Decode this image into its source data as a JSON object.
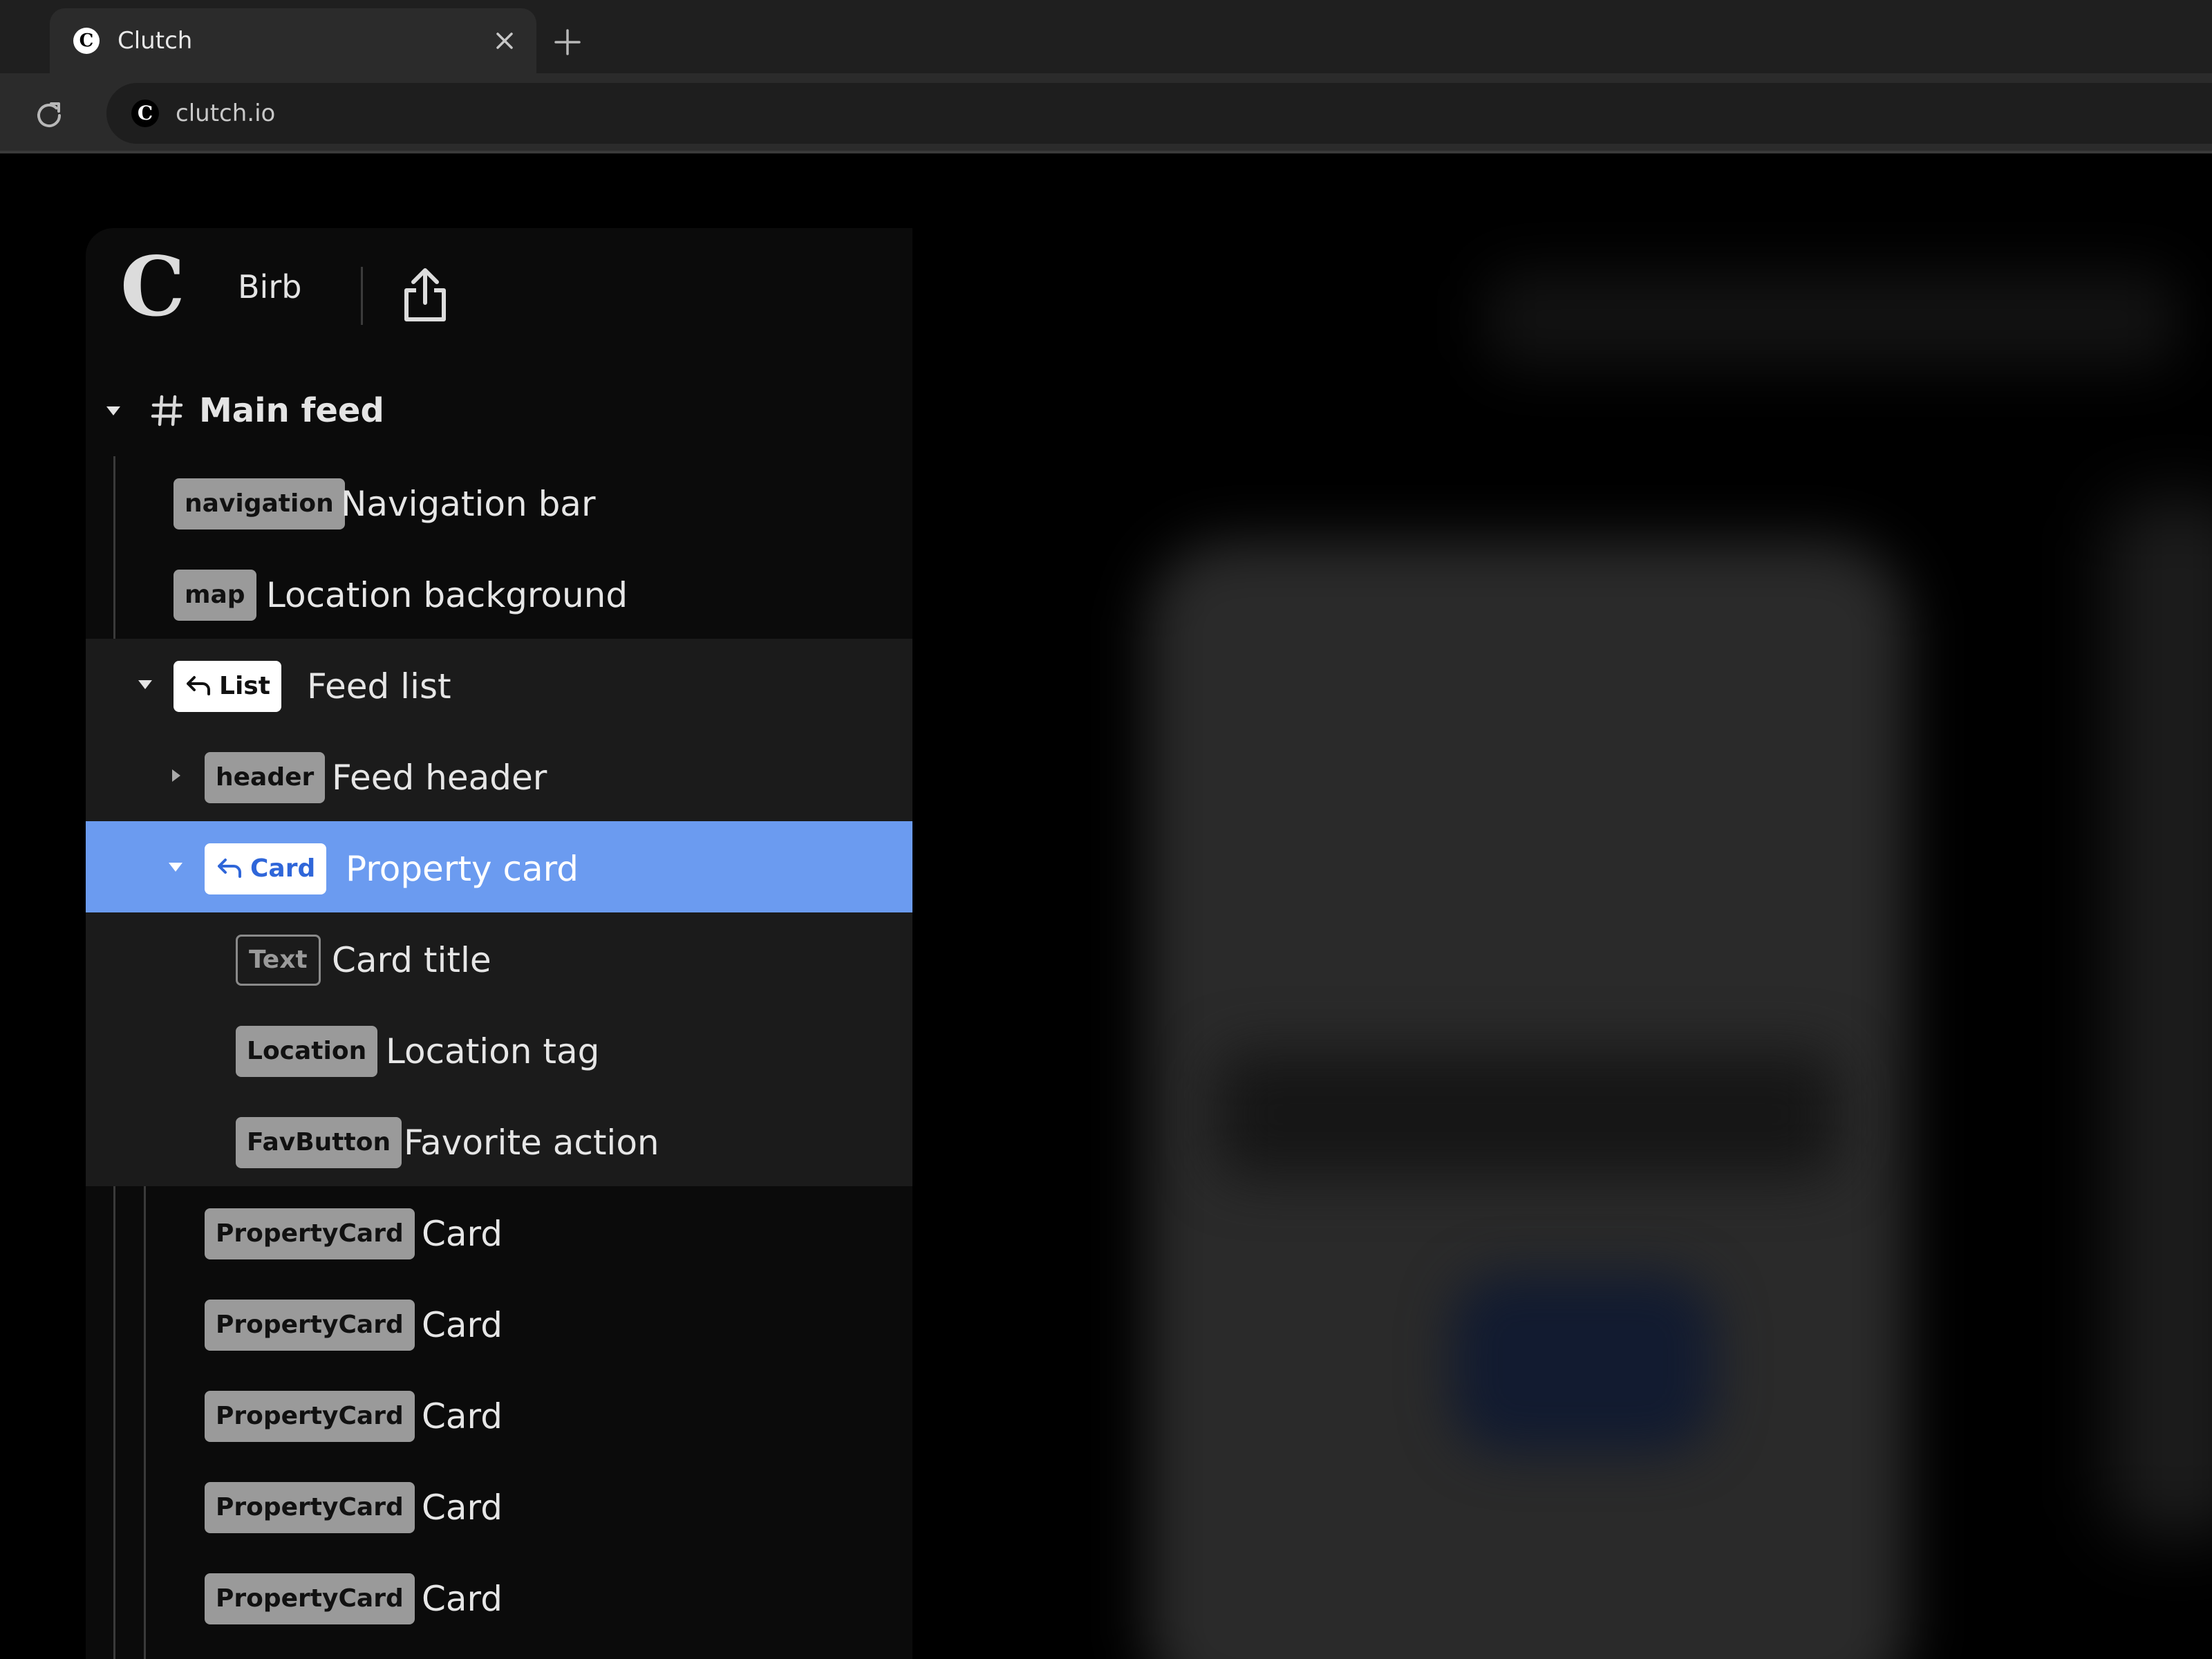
{
  "browser": {
    "tab": {
      "title": "Clutch",
      "favicon": "C",
      "close_icon": "close-icon"
    },
    "new_tab_icon": "plus-icon",
    "reload_icon": "reload-icon",
    "address": {
      "favicon": "C",
      "url": "clutch.io"
    }
  },
  "panel": {
    "logo": "C",
    "project": "Birb",
    "share_icon": "share-icon",
    "root": {
      "icon": "hash-icon",
      "title": "Main feed",
      "expanded": true
    },
    "rows": [
      {
        "badge": "navigation",
        "label": "Navigation bar"
      },
      {
        "badge": "map",
        "label": "Location background"
      },
      {
        "badge": "List",
        "label": "Feed list",
        "expanded": true,
        "ref_icon": "reply-arrow-icon"
      },
      {
        "badge": "header",
        "label": "Feed header",
        "expanded": false
      },
      {
        "badge": "Card",
        "label": "Property card",
        "expanded": true,
        "selected": true,
        "ref_icon": "reply-arrow-icon"
      },
      {
        "badge": "Text",
        "label": "Card title"
      },
      {
        "badge": "Location",
        "label": "Location tag"
      },
      {
        "badge": "FavButton",
        "label": "Favorite action"
      },
      {
        "badge": "PropertyCard",
        "label": "Card"
      },
      {
        "badge": "PropertyCard",
        "label": "Card"
      },
      {
        "badge": "PropertyCard",
        "label": "Card"
      },
      {
        "badge": "PropertyCard",
        "label": "Card"
      },
      {
        "badge": "PropertyCard",
        "label": "Card"
      }
    ]
  },
  "colors": {
    "selection": "#6b9bf0",
    "panel_bg": "#0b0b0b",
    "tint_bg": "#1b1b1b",
    "badge_gray": "#9a9a9a",
    "ref_blue": "#2f66d9"
  }
}
